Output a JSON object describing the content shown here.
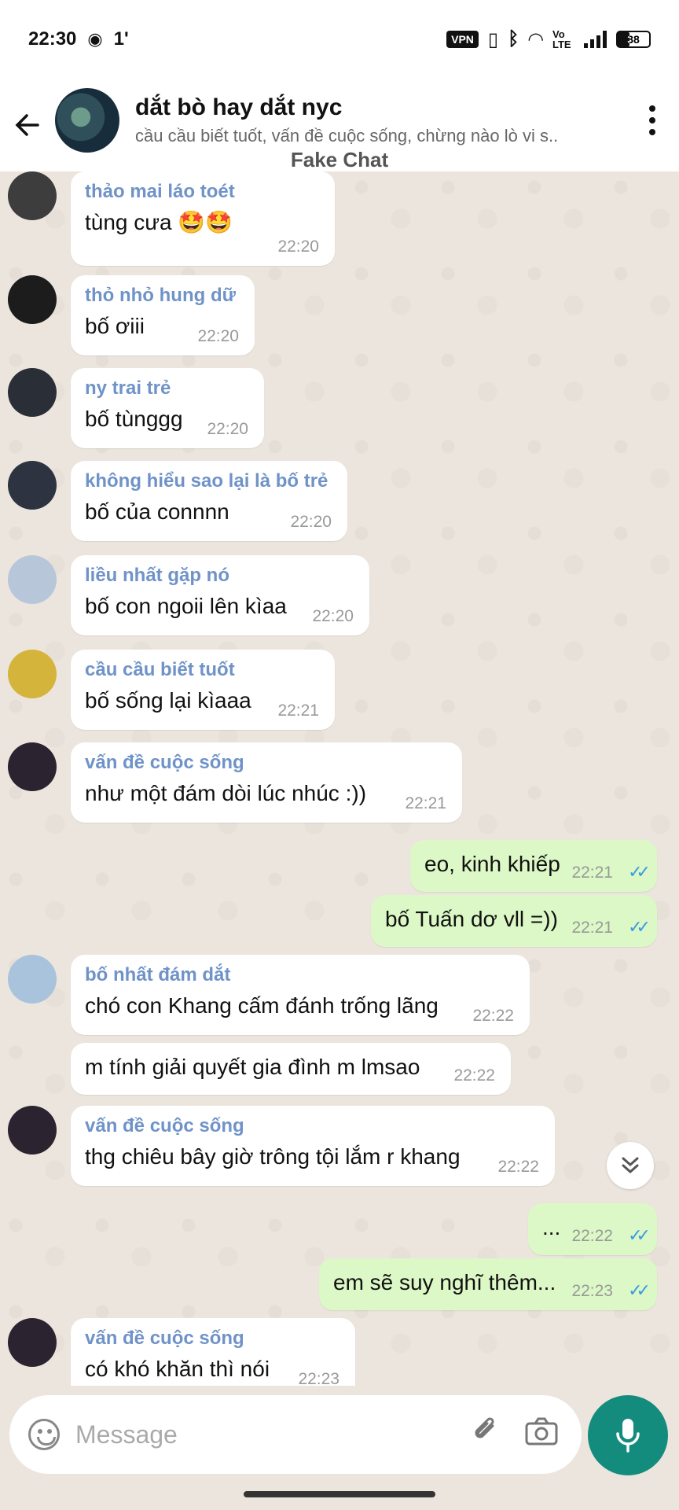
{
  "status_bar": {
    "time": "22:30",
    "notif_count": "1'",
    "vpn": "VPN",
    "volte": "Vo LTE",
    "battery": "38"
  },
  "header": {
    "title": "dắt bò hay dắt nyc",
    "subtitle": "cầu cầu biết tuốt, vấn đề cuộc sống, chừng nào lò vi s..",
    "label": "Fake Chat"
  },
  "messages": [
    {
      "sender": "thảo mai láo toét",
      "text": "tùng cưa 🤩🤩",
      "time": "22:20"
    },
    {
      "sender": "thỏ nhỏ hung dữ",
      "text": "bố ơiii",
      "time": "22:20"
    },
    {
      "sender": "ny trai trẻ",
      "text": "bố tùnggg",
      "time": "22:20"
    },
    {
      "sender": "không hiểu sao lại là bố trẻ",
      "text": "bố của connnn",
      "time": "22:20"
    },
    {
      "sender": "liều nhất gặp nó",
      "text": "bố con ngoii lên kìaa",
      "time": "22:20"
    },
    {
      "sender": "cầu cầu biết tuốt",
      "text": "bố sống lại kìaaa",
      "time": "22:21"
    },
    {
      "sender": "vấn đề cuộc sống",
      "text": "như một đám dòi lúc nhúc :))",
      "time": "22:21"
    },
    {
      "text": "eo, kinh khiếp",
      "time": "22:21"
    },
    {
      "text": "bố Tuấn dơ vll =))",
      "time": "22:21"
    },
    {
      "sender": "bố nhất đám dắt",
      "text": "chó con Khang cấm đánh trống lãng",
      "time": "22:22"
    },
    {
      "text": "m tính giải quyết gia đình m lmsao",
      "time": "22:22"
    },
    {
      "sender": "vấn đề cuộc sống",
      "text": "thg chiêu bây giờ trông tội lắm r khang",
      "time": "22:22"
    },
    {
      "text": "...",
      "time": "22:22"
    },
    {
      "text": "em sẽ suy nghĩ thêm...",
      "time": "22:23"
    },
    {
      "sender": "vấn đề cuộc sống",
      "text": "có khó khăn thì nói",
      "time": "22:23"
    }
  ],
  "input": {
    "placeholder": "Message"
  },
  "colors": {
    "accent": "#148c7d",
    "sender_name": "#6f93c8",
    "outgoing_bubble": "#dcf8c6",
    "read_ticks": "#3a9be0"
  },
  "icons": [
    "back-arrow-icon",
    "more-options-icon",
    "emoji-icon",
    "attach-icon",
    "camera-icon",
    "mic-icon",
    "scroll-down-icon"
  ]
}
